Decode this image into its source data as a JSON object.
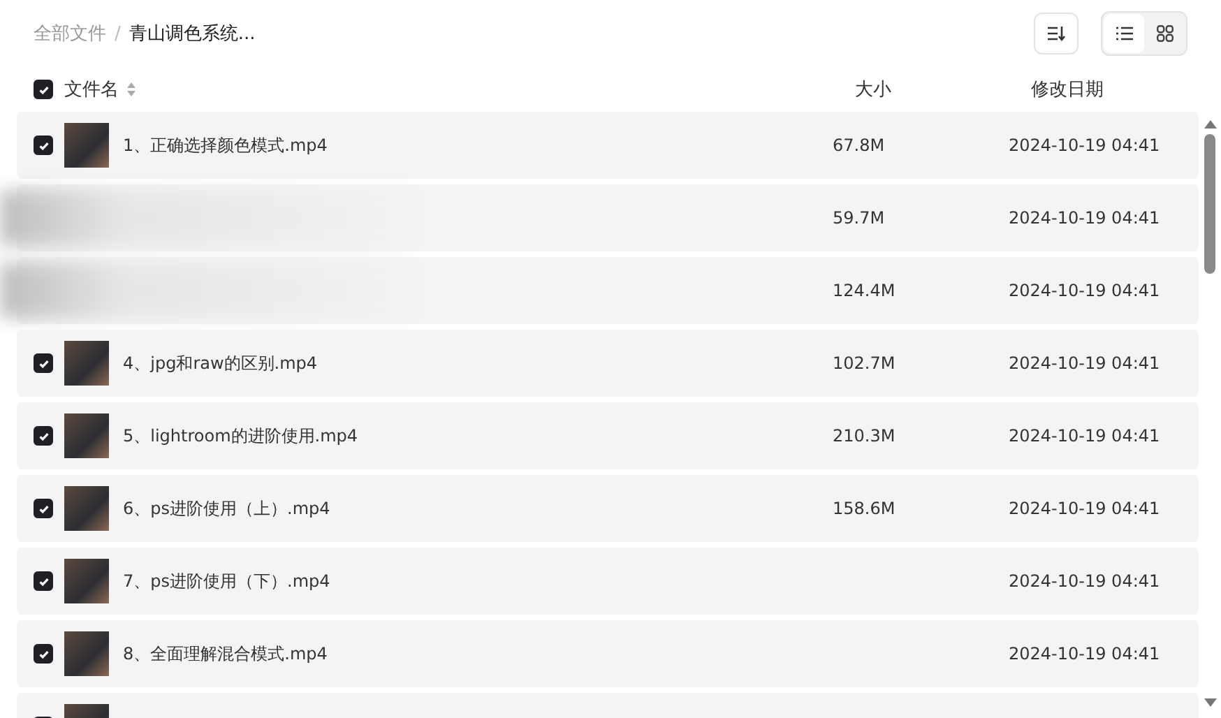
{
  "breadcrumb_separator": "/",
  "breadcrumb": [
    {
      "label": "全部文件",
      "current": false
    },
    {
      "label": "青山调色系统...",
      "current": true
    }
  ],
  "view_modes": [
    {
      "kind": "list",
      "selected": true
    },
    {
      "kind": "grid",
      "selected": false
    }
  ],
  "table": {
    "all_checked": true,
    "columns": [
      "文件名",
      "大小",
      "修改日期"
    ],
    "rows": [
      {
        "checked": true,
        "name": "1、正确选择颜色模式.mp4",
        "size": "67.8M",
        "date": "2024-10-19 04:41"
      },
      {
        "blurred": true,
        "size": "59.7M",
        "date": "2024-10-19 04:41"
      },
      {
        "blurred": true,
        "size": "124.4M",
        "date": "2024-10-19 04:41"
      },
      {
        "checked": true,
        "name": "4、jpg和raw的区别.mp4",
        "size": "102.7M",
        "date": "2024-10-19 04:41"
      },
      {
        "checked": true,
        "name": "5、lightroom的进阶使用.mp4",
        "size": "210.3M",
        "date": "2024-10-19 04:41"
      },
      {
        "checked": true,
        "name": "6、ps进阶使用（上）.mp4",
        "size": "158.6M",
        "date": "2024-10-19 04:41"
      },
      {
        "checked": true,
        "name": "7、ps进阶使用（下）.mp4",
        "date": "2024-10-19 04:41"
      },
      {
        "checked": true,
        "name": "8、全面理解混合模式.mp4",
        "date": "2024-10-19 04:41"
      },
      {
        "checked": true
      }
    ]
  }
}
